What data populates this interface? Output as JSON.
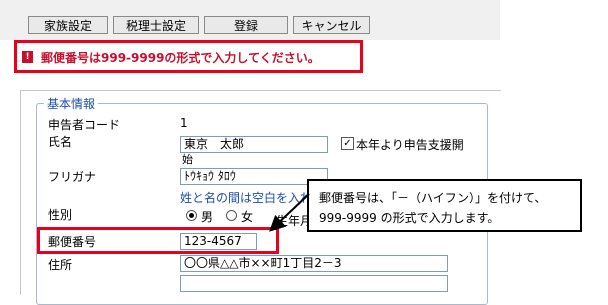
{
  "toolbar": {
    "family_label": "家族設定",
    "accountant_label": "税理士設定",
    "register_label": "登録",
    "cancel_label": "キャンセル"
  },
  "error": {
    "icon": "!",
    "message": "郵便番号は999-9999の形式で入力してください。"
  },
  "section": {
    "title": "基本情報"
  },
  "form": {
    "code_label": "申告者コード",
    "code_value": "1",
    "name_label": "氏名",
    "name_value": "東京　太郎",
    "support_label": "本年より申告支援開",
    "support_label_cont": "始",
    "kana_label": "フリガナ",
    "kana_value": "ﾄｳｷｮｳ ﾀﾛｳ",
    "hint": "姓と名の間は空白を入れ",
    "gender_label": "性別",
    "male_label": "男",
    "female_label": "女",
    "birth_label": "生年月",
    "postal_label": "郵便番号",
    "postal_value": "123-4567",
    "address_label": "住所",
    "address_value": "〇〇県△△市××町1丁目2－3",
    "address2_value": ""
  },
  "callout": {
    "line1": "郵便番号は、「－（ハイフン）」を付けて、",
    "line2": "999-9999 の形式で入力します。"
  },
  "colors": {
    "alert_red": "#e8001c",
    "error_text": "#c8102e",
    "section_blue": "#1e4ea8"
  },
  "icons": {
    "support_checkbox": "checkmark",
    "error": "exclamation-icon"
  }
}
